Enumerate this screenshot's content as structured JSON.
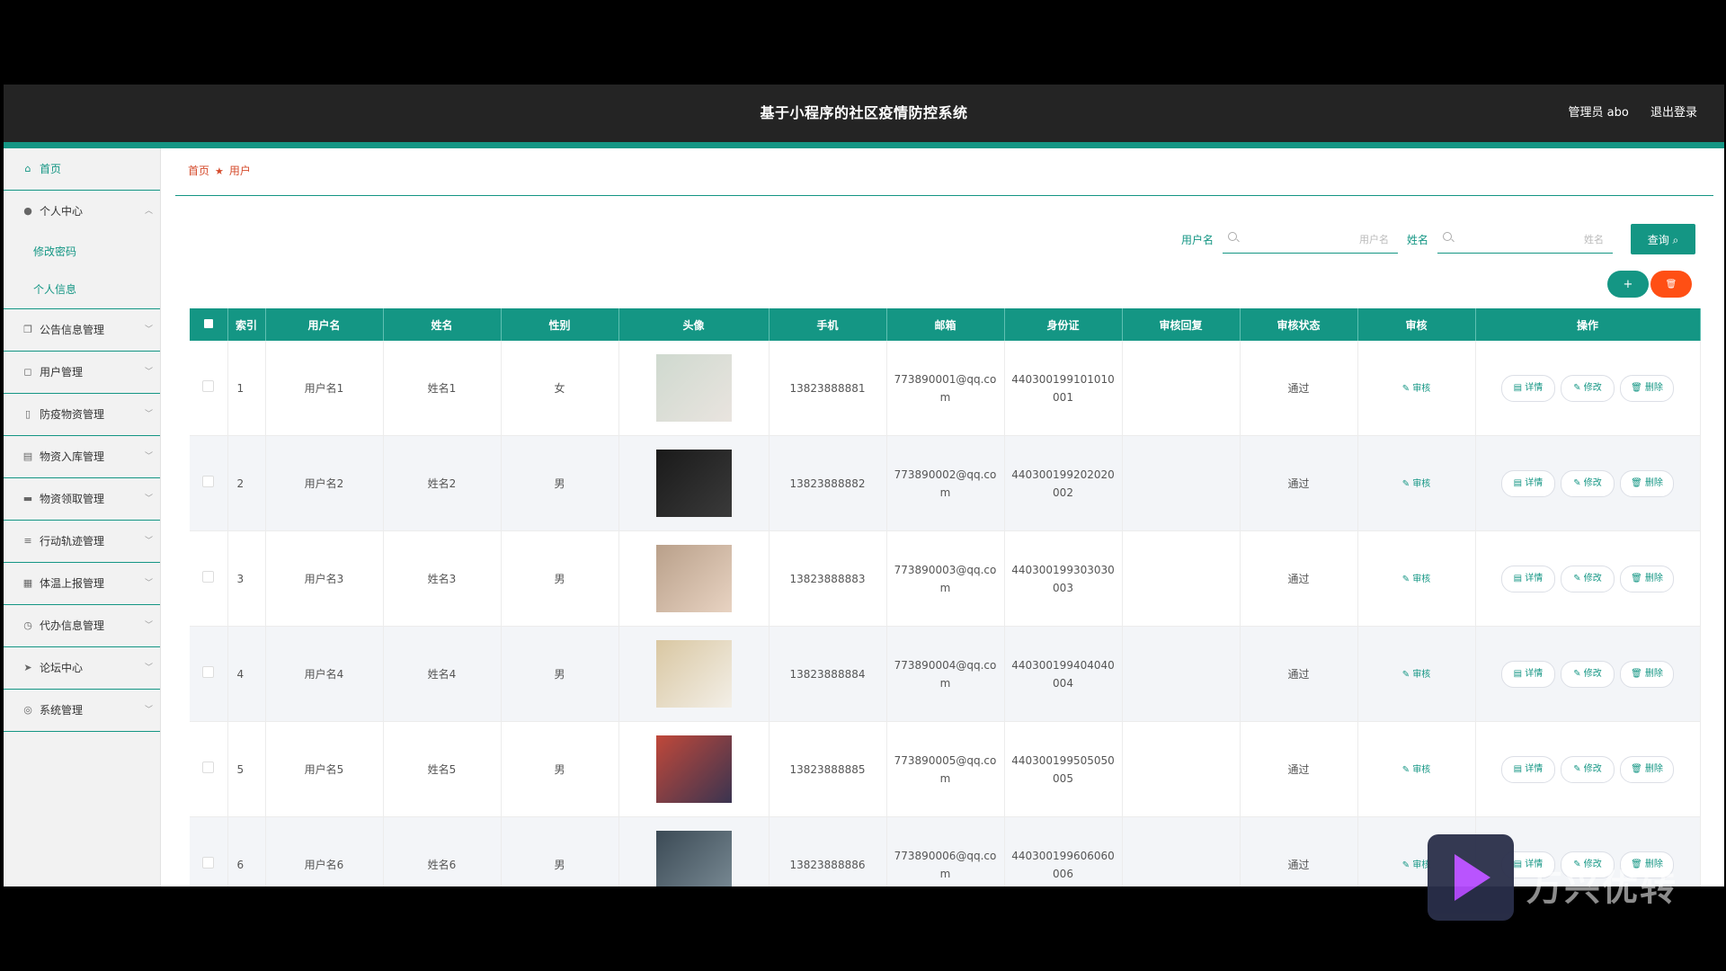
{
  "header": {
    "title": "基于小程序的社区疫情防控系统",
    "admin_label": "管理员 abo",
    "logout_label": "退出登录"
  },
  "sidebar": {
    "items": [
      {
        "label": "首页",
        "icon": "home-icon",
        "glyph": "⌂",
        "active": true
      },
      {
        "label": "个人中心",
        "icon": "user-icon",
        "glyph": "●",
        "expanded": true,
        "children": [
          {
            "label": "修改密码"
          },
          {
            "label": "个人信息"
          }
        ]
      },
      {
        "label": "公告信息管理",
        "icon": "copy-icon",
        "glyph": "❐"
      },
      {
        "label": "用户管理",
        "icon": "crop-icon",
        "glyph": "◻"
      },
      {
        "label": "防疫物资管理",
        "icon": "bottle-icon",
        "glyph": "▯"
      },
      {
        "label": "物资入库管理",
        "icon": "chart-icon",
        "glyph": "▤"
      },
      {
        "label": "物资领取管理",
        "icon": "monitor-icon",
        "glyph": "▬"
      },
      {
        "label": "行动轨迹管理",
        "icon": "list-icon",
        "glyph": "≡"
      },
      {
        "label": "体温上报管理",
        "icon": "grid-icon",
        "glyph": "▦"
      },
      {
        "label": "代办信息管理",
        "icon": "clock-icon",
        "glyph": "◷"
      },
      {
        "label": "论坛中心",
        "icon": "send-icon",
        "glyph": "➤"
      },
      {
        "label": "系统管理",
        "icon": "settings-icon",
        "glyph": "◎"
      }
    ]
  },
  "breadcrumb": {
    "home": "首页",
    "current": "用户",
    "icon": "star-icon"
  },
  "search": {
    "username_label": "用户名",
    "username_placeholder": "用户名",
    "name_label": "姓名",
    "name_placeholder": "姓名",
    "query_label": "查询 ⌕"
  },
  "actions": {
    "add_label": "+",
    "delete_label": "🗑"
  },
  "table": {
    "columns": [
      "索引",
      "用户名",
      "姓名",
      "性别",
      "头像",
      "手机",
      "邮箱",
      "身份证",
      "审核回复",
      "审核状态",
      "审核",
      "操作"
    ],
    "audit_label": "✎ 审核",
    "ops": {
      "detail": "▤ 详情",
      "edit": "✎ 修改",
      "delete": "🗑 删除"
    },
    "rows": [
      {
        "index": "1",
        "username": "用户名1",
        "name": "姓名1",
        "gender": "女",
        "phone": "13823888881",
        "email": "773890001@qq.com",
        "id_card": "440300199101010001",
        "reply": "",
        "status": "通过",
        "avatar_colors": [
          "#cfd9cf",
          "#e9e4df"
        ]
      },
      {
        "index": "2",
        "username": "用户名2",
        "name": "姓名2",
        "gender": "男",
        "phone": "13823888882",
        "email": "773890002@qq.com",
        "id_card": "440300199202020002",
        "reply": "",
        "status": "通过",
        "avatar_colors": [
          "#1a1a1a",
          "#3a3a3a"
        ]
      },
      {
        "index": "3",
        "username": "用户名3",
        "name": "姓名3",
        "gender": "男",
        "phone": "13823888883",
        "email": "773890003@qq.com",
        "id_card": "440300199303030003",
        "reply": "",
        "status": "通过",
        "avatar_colors": [
          "#b9a08a",
          "#e8d3c2"
        ]
      },
      {
        "index": "4",
        "username": "用户名4",
        "name": "姓名4",
        "gender": "男",
        "phone": "13823888884",
        "email": "773890004@qq.com",
        "id_card": "440300199404040004",
        "reply": "",
        "status": "通过",
        "avatar_colors": [
          "#d9c7a2",
          "#f3efe7"
        ]
      },
      {
        "index": "5",
        "username": "用户名5",
        "name": "姓名5",
        "gender": "男",
        "phone": "13823888885",
        "email": "773890005@qq.com",
        "id_card": "440300199505050005",
        "reply": "",
        "status": "通过",
        "avatar_colors": [
          "#c0483a",
          "#3a3450"
        ]
      },
      {
        "index": "6",
        "username": "用户名6",
        "name": "姓名6",
        "gender": "男",
        "phone": "13823888886",
        "email": "773890006@qq.com",
        "id_card": "440300199606060006",
        "reply": "",
        "status": "通过",
        "avatar_colors": [
          "#3b4a55",
          "#7b8c96"
        ]
      }
    ]
  },
  "watermark": {
    "text": "万兴优转"
  },
  "colors": {
    "accent": "#149684",
    "danger": "#ff4f14",
    "header_bg": "#242424"
  }
}
